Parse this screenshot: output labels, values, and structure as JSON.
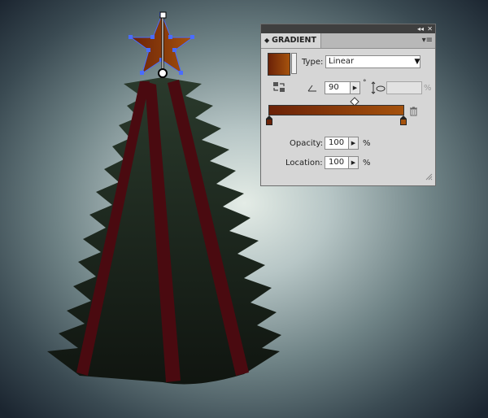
{
  "panel": {
    "tab_label": "GRADIENT",
    "tab_arrows": "◆",
    "collapse_icon": "◂◂",
    "close_icon": "✕",
    "menu_icon": "▾≡",
    "type_label": "Type:",
    "type_value": "Linear",
    "angle_value": "90",
    "degree_symbol": "°",
    "aspect_value": "",
    "aspect_unit": "%",
    "opacity_label": "Opacity:",
    "opacity_value": "100",
    "opacity_unit": "%",
    "location_label": "Location:",
    "location_value": "100",
    "location_unit": "%",
    "gradient_start_color": "#6b2208",
    "gradient_end_color": "#a5520d",
    "icons": {
      "reverse": "reverse-gradient-icon",
      "angle": "angle-icon",
      "aspect": "aspect-ratio-icon",
      "delete_stop": "trash-icon",
      "dropdown": "chevron-down-icon",
      "stepper": "triangle-right-icon"
    }
  },
  "artwork": {
    "tree_color": "#1d2a22",
    "stripe_color": "#4a0a10",
    "star_color": "#a84a12",
    "selection_color": "#4a6cff"
  }
}
